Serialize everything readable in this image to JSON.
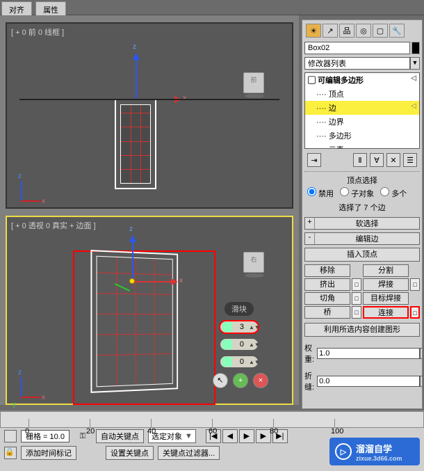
{
  "tabs": {
    "align": "对齐",
    "props": "属性"
  },
  "viewport_top": {
    "label": "[ + 0 前 0 线框 ]",
    "axes": {
      "z": "z",
      "x": "x"
    }
  },
  "viewport_bottom": {
    "label": "[ + 0 透视 0 真实 + 边面 ]",
    "axes": {
      "z": "z",
      "x": "x",
      "y": "y"
    }
  },
  "viewcube": {
    "top": "前",
    "bot": "右"
  },
  "slider": {
    "label": "滑块",
    "val1": "3",
    "val2": "0",
    "val3": "0"
  },
  "object_name": "Box02",
  "modifier_list_label": "修改器列表",
  "stack": {
    "root": "可编辑多边形",
    "vertex": "顶点",
    "edge": "边",
    "border": "边界",
    "polygon": "多边形",
    "element": "元素"
  },
  "sel_radio": {
    "label_head": "顶点选择",
    "disable": "禁用",
    "subobj": "子对象",
    "multi": "多个"
  },
  "sel_info": "选择了 7 个边",
  "rollouts": {
    "soft": {
      "sign": "+",
      "title": "软选择"
    },
    "editedge": {
      "sign": "-",
      "title": "编辑边"
    }
  },
  "buttons": {
    "insert_vertex": "插入顶点",
    "remove": "移除",
    "split": "分割",
    "extrude": "挤出",
    "weld": "焊接",
    "chamfer": "切角",
    "target_weld": "目标焊接",
    "bridge": "桥",
    "connect": "连接",
    "create_shape": "利用所选内容创建图形"
  },
  "params": {
    "weight_label": "权重:",
    "weight_val": "1.0",
    "crease_label": "折缝:",
    "crease_val": "0.0"
  },
  "timeline": {
    "ticks": [
      "0",
      "20",
      "40",
      "60",
      "80",
      "100"
    ],
    "grid_label": "栅格 = 10.0",
    "autokey": "自动关键点",
    "selected": "选定对象",
    "add_time_tag": "添加时间标记",
    "set_key": "设置关键点",
    "key_filters": "关键点过滤器..."
  },
  "watermark": {
    "title": "溜溜自学",
    "sub": "zixue.3d66.com",
    "logo_icon": "▷"
  }
}
